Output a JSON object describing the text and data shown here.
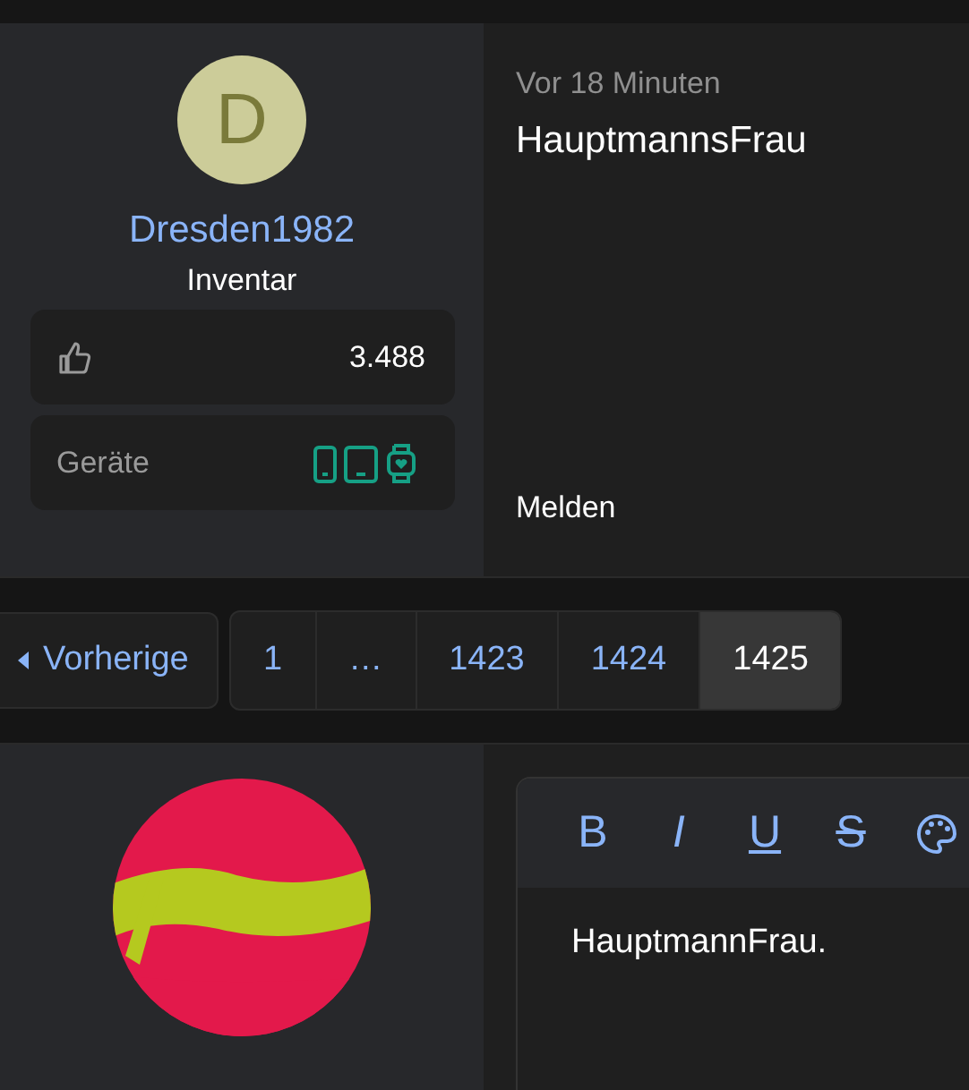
{
  "post": {
    "avatar_letter": "D",
    "username": "Dresden1982",
    "rank": "Inventar",
    "likes": "3.488",
    "devices_label": "Geräte",
    "time": "Vor 18 Minuten",
    "text": "HauptmannsFrau",
    "report": "Melden"
  },
  "pagination": {
    "previous": "Vorherige",
    "pages": [
      {
        "label": "1",
        "selected": false
      },
      {
        "label": "…",
        "selected": false
      },
      {
        "label": "1423",
        "selected": false
      },
      {
        "label": "1424",
        "selected": false
      },
      {
        "label": "1425",
        "selected": true
      }
    ]
  },
  "reply": {
    "toolbar": [
      {
        "kind": "bold",
        "label": "B"
      },
      {
        "kind": "italic",
        "label": "I"
      },
      {
        "kind": "underline",
        "label": "U"
      },
      {
        "kind": "strike",
        "label": "S"
      },
      {
        "kind": "palette"
      }
    ],
    "text": "HauptmannFrau."
  }
}
